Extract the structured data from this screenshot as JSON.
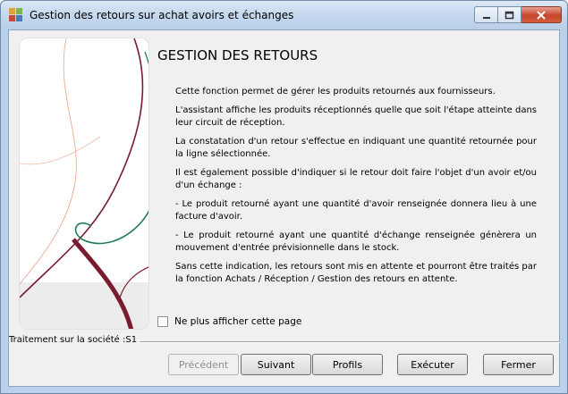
{
  "window": {
    "title": "Gestion des retours sur achat avoirs et échanges",
    "icon": "app-icon",
    "controls": {
      "minimize": "minimize-icon",
      "maximize": "maximize-icon",
      "close": "close-icon"
    }
  },
  "page": {
    "title": "GESTION DES RETOURS",
    "paragraphs": [
      "Cette fonction permet de gérer les produits retournés aux fournisseurs.",
      "L'assistant affiche les produits réceptionnés quelle que soit l'étape atteinte dans leur circuit de réception.",
      "La constatation d'un retour s'effectue en indiquant une quantité retournée pour la ligne sélectionnée.",
      "Il est également possible d'indiquer si le retour doit faire l'objet d'un avoir et/ou d'un échange :",
      "- Le produit retourné ayant une quantité d'avoir renseignée donnera lieu à une facture d'avoir.",
      "- Le produit retourné ayant une quantité d'échange renseignée génèrera un mouvement d'entrée prévisionnelle dans le stock.",
      "Sans cette indication, les retours sont mis en attente et pourront être traités par la fonction Achats / Réception / Gestion des retours en attente."
    ],
    "checkbox_label": "Ne plus afficher cette page",
    "checkbox_checked": false
  },
  "status": {
    "company": "Traitement sur la société :S1"
  },
  "buttons": {
    "previous": "Précédent",
    "next": "Suivant",
    "profiles": "Profils",
    "execute": "Exécuter",
    "close": "Fermer"
  },
  "colors": {
    "accent_red": "#7a1a2e",
    "accent_green": "#1f7a5a",
    "close_button": "#c8452c"
  }
}
